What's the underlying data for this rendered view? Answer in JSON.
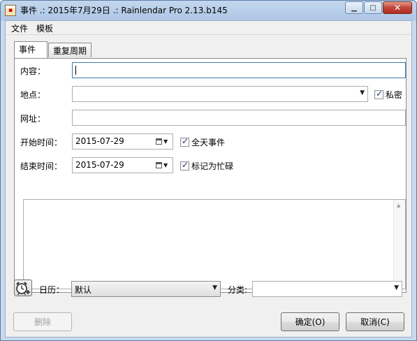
{
  "window": {
    "title": "事件 .: 2015年7月29日 .: Rainlendar Pro 2.13.b145",
    "minimize_glyph": "▁",
    "maximize_glyph": "□",
    "close_glyph": "✕"
  },
  "menu": {
    "items": [
      "文件",
      "模板"
    ]
  },
  "tabs": [
    "事件",
    "重复周期"
  ],
  "form": {
    "content_label": "内容：",
    "content_value": "",
    "location_label": "地点：",
    "location_value": "",
    "private_label": "私密",
    "private_checked": true,
    "url_label": "网址：",
    "url_value": "",
    "start_label": "开始时间：",
    "start_date": "2015-07-29",
    "all_day_label": "全天事件",
    "all_day_checked": true,
    "end_label": "结束时间：",
    "end_date": "2015-07-29",
    "busy_label": "标记为忙碌",
    "busy_checked": true,
    "notes_value": ""
  },
  "bottom": {
    "calendar_label": "日历：",
    "calendar_value": "默认",
    "category_label": "分类:",
    "category_value": ""
  },
  "buttons": {
    "delete": "删除",
    "ok": "确定(O)",
    "cancel": "取消(C)"
  },
  "icons": {
    "app": "rainlendar-calendar-icon",
    "alarm": "alarm-clock-add-icon",
    "dropdown": "chevron-down-icon",
    "date_picker": "calendar-icon"
  }
}
